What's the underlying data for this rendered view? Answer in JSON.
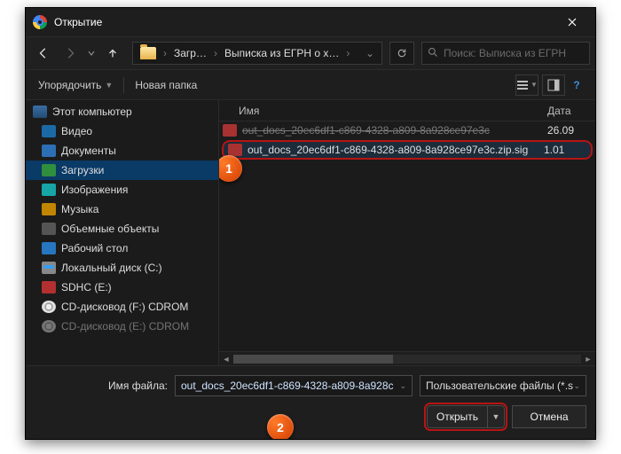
{
  "window": {
    "title": "Открытие",
    "close_tooltip": "Close"
  },
  "nav": {
    "crumb1": "Загр…",
    "crumb2": "Выписка из ЕГРН о х…",
    "search_placeholder": "Поиск: Выписка из ЕГРН"
  },
  "toolbar": {
    "organize": "Упорядочить",
    "new_folder": "Новая папка"
  },
  "tree": {
    "root": "Этот компьютер",
    "items": [
      {
        "label": "Видео"
      },
      {
        "label": "Документы"
      },
      {
        "label": "Загрузки"
      },
      {
        "label": "Изображения"
      },
      {
        "label": "Музыка"
      },
      {
        "label": "Объемные объекты"
      },
      {
        "label": "Рабочий стол"
      },
      {
        "label": "Локальный диск (C:)"
      },
      {
        "label": "SDHC (E:)"
      },
      {
        "label": "CD-дисковод (F:) CDROM"
      },
      {
        "label": "CD-дисковод (E:) CDROM"
      }
    ],
    "selected_index": 2
  },
  "list": {
    "col_name": "Имя",
    "col_date": "Дата",
    "rows": [
      {
        "name": "out_docs_20ec6df1-c869-4328-a809-8a928ce97e3c",
        "date": "26.09",
        "struck": true
      },
      {
        "name": "out_docs_20ec6df1-c869-4328-a809-8a928ce97e3c.zip.sig",
        "date": "1.01",
        "selected": true
      }
    ]
  },
  "footer": {
    "filename_label": "Имя файла:",
    "filename_value": "out_docs_20ec6df1-c869-4328-a809-8a928c",
    "filter_value": "Пользовательские файлы (*.s",
    "open": "Открыть",
    "cancel": "Отмена"
  },
  "callouts": {
    "one": "1",
    "two": "2"
  }
}
